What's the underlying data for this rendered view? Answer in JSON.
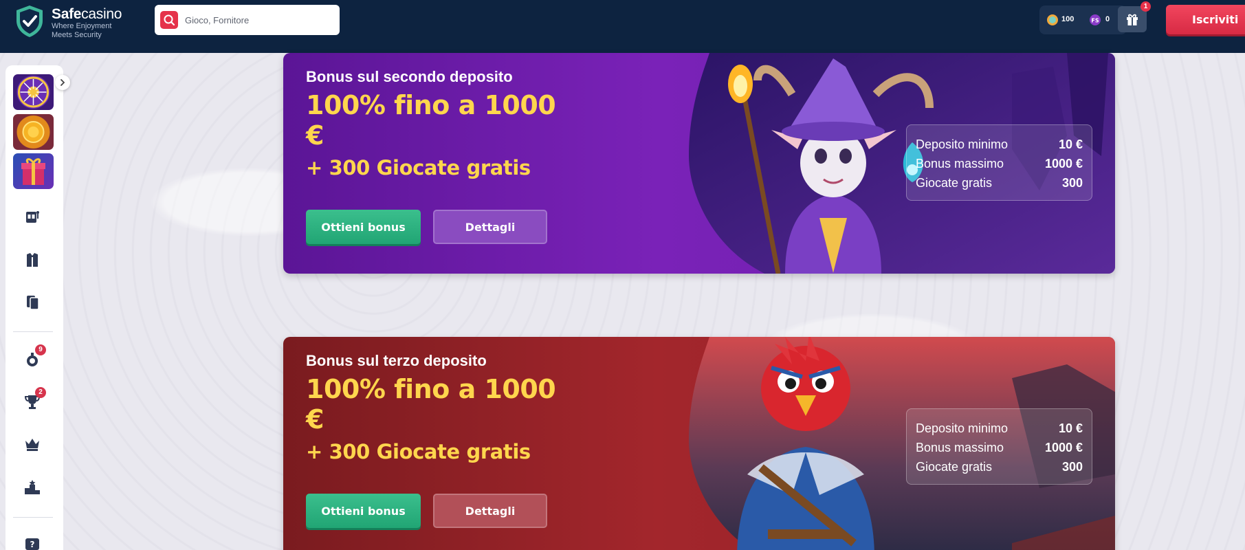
{
  "brand": {
    "name_bold": "Safe",
    "name_light": "casino",
    "tagline": "Where Enjoyment Meets Security"
  },
  "search": {
    "placeholder": "Gioco, Fornitore"
  },
  "wallet": {
    "coins": "100",
    "free_spins": "0"
  },
  "gift": {
    "badge": "1"
  },
  "header": {
    "signup_label": "Iscriviti"
  },
  "sidebar": {
    "badges": {
      "bets": "9",
      "tournaments": "2"
    }
  },
  "promos": [
    {
      "subtitle": "Bonus sul secondo deposito",
      "title": "100% fino a 1000 €",
      "extra": "+ 300 Giocate gratis",
      "get_label": "Ottieni bonus",
      "details_label": "Dettagli",
      "rows": [
        {
          "label": "Deposito minimo",
          "value": "10 €"
        },
        {
          "label": "Bonus massimo",
          "value": "1000 €"
        },
        {
          "label": "Giocate gratis",
          "value": "300"
        }
      ]
    },
    {
      "subtitle": "Bonus sul terzo deposito",
      "title": "100% fino a 1000 €",
      "extra": "+ 300 Giocate gratis",
      "get_label": "Ottieni bonus",
      "details_label": "Dettagli",
      "rows": [
        {
          "label": "Deposito minimo",
          "value": "10 €"
        },
        {
          "label": "Bonus massimo",
          "value": "1000 €"
        },
        {
          "label": "Giocate gratis",
          "value": "300"
        }
      ]
    }
  ],
  "colors": {
    "header_bg": "#0d2340",
    "accent_red": "#e5324a",
    "cta_green": "#21a574",
    "promo_gold": "#ffd64d"
  }
}
